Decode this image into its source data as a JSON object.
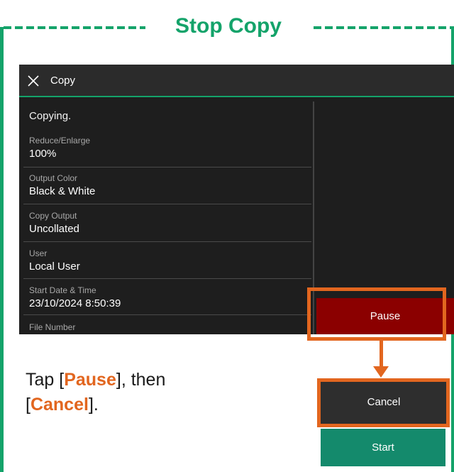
{
  "title": "Stop Copy",
  "screen": {
    "header_title": "Copy",
    "status": "Copying.",
    "rows": [
      {
        "label": "Reduce/Enlarge",
        "value": "100%"
      },
      {
        "label": "Output Color",
        "value": "Black & White"
      },
      {
        "label": "Copy Output",
        "value": "Uncollated"
      },
      {
        "label": "User",
        "value": "Local User"
      },
      {
        "label": "Start Date & Time",
        "value": "23/10/2024 8:50:39"
      },
      {
        "label": "File Number",
        "value": ""
      }
    ],
    "pause_label": "Pause"
  },
  "instruction": {
    "part1": "Tap [",
    "pause": "Pause",
    "part2": "], then",
    "part3": "[",
    "cancel": "Cancel",
    "part4": "]."
  },
  "buttons": {
    "cancel_label": "Cancel",
    "start_label": "Start"
  },
  "colors": {
    "frame_green": "#14a36a",
    "highlight_orange": "#e2661f",
    "pause_red": "#8b0000",
    "start_teal": "#148a6c"
  },
  "icons": {
    "close": "close-icon",
    "arrow": "arrow-down-icon"
  }
}
